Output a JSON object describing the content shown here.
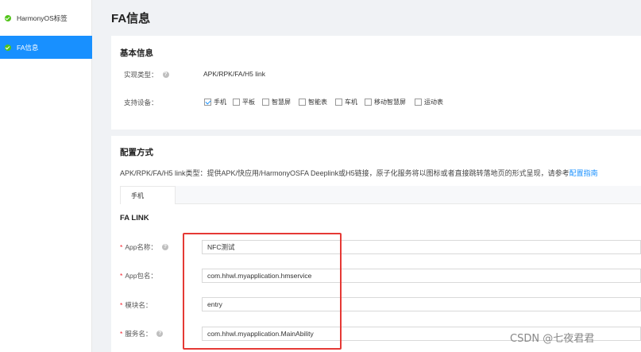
{
  "sidebar": {
    "items": [
      {
        "label": "HarmonyOS标签",
        "active": false
      },
      {
        "label": "FA信息",
        "active": true
      }
    ]
  },
  "page": {
    "title": "FA信息"
  },
  "basic_info": {
    "title": "基本信息",
    "impl_type_label": "实现类型：",
    "impl_type_value": "APK/RPK/FA/H5 link",
    "devices_label": "支持设备：",
    "devices": [
      {
        "label": "手机",
        "checked": true
      },
      {
        "label": "平板",
        "checked": false
      },
      {
        "label": "智慧屏",
        "checked": false
      },
      {
        "label": "智能表",
        "checked": false
      },
      {
        "label": "车机",
        "checked": false
      },
      {
        "label": "移动智慧屏",
        "checked": false
      },
      {
        "label": "运动表",
        "checked": false
      }
    ]
  },
  "config": {
    "title": "配置方式",
    "desc_text": "APK/RPK/FA/H5 link类型：提供APK/快应用/HarmonyOSFA Deeplink或H5链接，原子化服务将以图标或者直接跳转落地页的形式呈现，请参考",
    "desc_link": "配置指南",
    "tabs": [
      "手机"
    ],
    "fa_link_title": "FA LINK",
    "fields": [
      {
        "label": "App名称：",
        "value": "NFC测试",
        "help": true
      },
      {
        "label": "App包名：",
        "value": "com.hhwl.myapplication.hmservice",
        "help": false
      },
      {
        "label": "模块名：",
        "value": "entry",
        "help": false
      },
      {
        "label": "服务名：",
        "value": "com.hhwl.myapplication.MainAbility",
        "help": true
      }
    ],
    "required_mark": "*",
    "help_glyph": "?"
  },
  "watermark": "CSDN @七夜君君",
  "colors": {
    "accent": "#1890ff",
    "success": "#52c41a",
    "highlight": "#e53935",
    "required": "#f5222d"
  }
}
